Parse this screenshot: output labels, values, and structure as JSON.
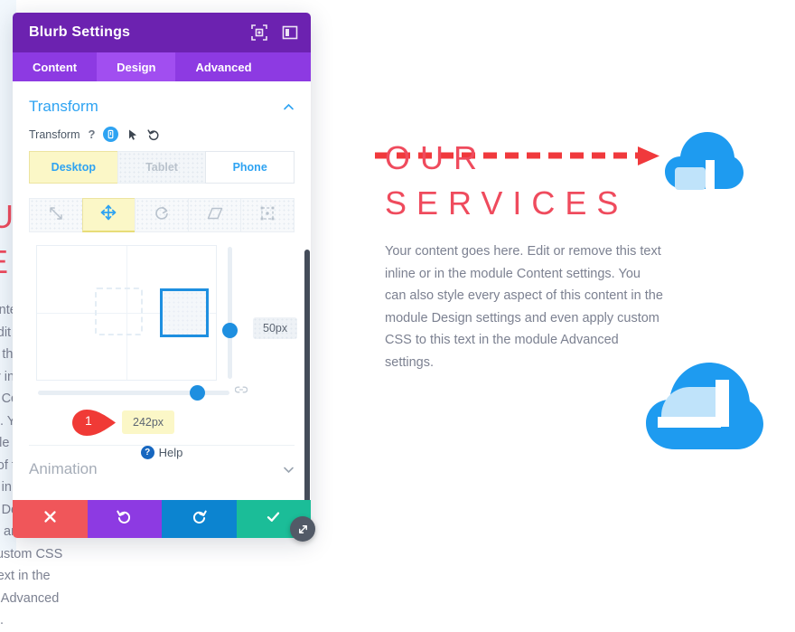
{
  "modal": {
    "title": "Blurb Settings",
    "header_icons": [
      {
        "name": "focus-icon",
        "label": "Focus"
      },
      {
        "name": "layout-icon",
        "label": "Layout"
      }
    ],
    "tabs": [
      {
        "label": "Content",
        "active": false
      },
      {
        "label": "Design",
        "active": true
      },
      {
        "label": "Advanced",
        "active": false
      }
    ],
    "sections": [
      {
        "title": "Transform",
        "expanded": true
      },
      {
        "title": "Animation",
        "expanded": false
      }
    ],
    "transform": {
      "field_label": "Transform",
      "help_glyph": "?",
      "responsive_icon": "device-icon",
      "hover_icon": "cursor-icon",
      "reset_icon": "reset-icon",
      "devices": [
        {
          "label": "Desktop",
          "state": "active"
        },
        {
          "label": "Tablet",
          "state": "disabled"
        },
        {
          "label": "Phone",
          "state": "normal"
        }
      ],
      "modes": [
        {
          "name": "scale-icon",
          "active": false
        },
        {
          "name": "translate-icon",
          "active": true
        },
        {
          "name": "rotate-icon",
          "active": false
        },
        {
          "name": "skew-icon",
          "active": false
        },
        {
          "name": "origin-icon",
          "active": false
        }
      ],
      "vertical_value": "50px",
      "horizontal_value": "242px",
      "callout_number": "1",
      "link_icon": "link-icon"
    },
    "help_label": "Help",
    "help_badge": "?",
    "footer": [
      {
        "name": "cancel-button",
        "icon": "close-icon",
        "color": "#f0565a"
      },
      {
        "name": "undo-button",
        "icon": "undo-icon",
        "color": "#8d3ae2"
      },
      {
        "name": "redo-button",
        "icon": "redo-icon",
        "color": "#0c84d0"
      },
      {
        "name": "save-button",
        "icon": "check-icon",
        "color": "#1bbd98"
      }
    ],
    "resize_icon": "resize-handle-icon",
    "colors": {
      "header": "#6c22b0",
      "tabbar": "#8d3ae2",
      "tab_active": "#a14ef0",
      "accent": "#2ea3f2",
      "highlight": "#fbf7c7"
    }
  },
  "page": {
    "heading_line1": "OUR",
    "heading_line2": "SERVICES",
    "heading_color": "#ef4b5d",
    "body": "Your content goes here. Edit or remove this text inline or in the module Content settings. You can also style every aspect of this content in the module Design settings and even apply custom CSS to this text in the module Advanced settings.",
    "arrow": {
      "name": "dashed-arrow",
      "color": "#f0393c"
    },
    "clouds": [
      {
        "name": "cloud-icon-top",
        "color": "#1e9bf0",
        "accent": "#bfe3fa"
      },
      {
        "name": "cloud-icon-bottom",
        "color": "#1e9bf0",
        "accent": "#bfe3fa"
      }
    ]
  }
}
